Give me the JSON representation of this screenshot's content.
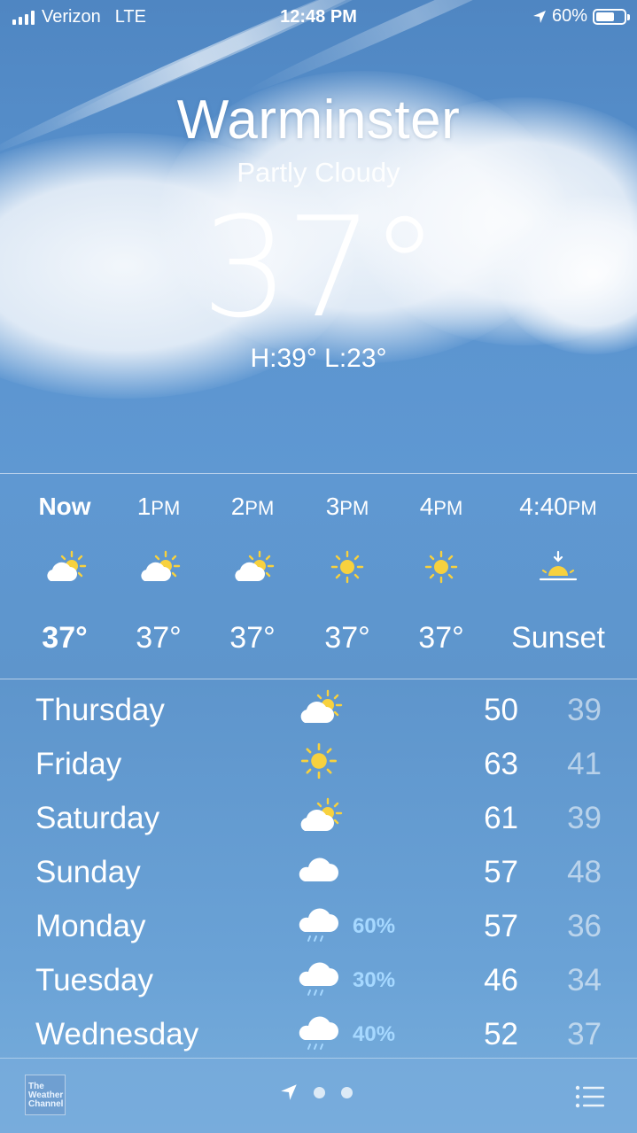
{
  "status_bar": {
    "carrier": "Verizon",
    "network": "LTE",
    "time": "12:48 PM",
    "battery": "60%",
    "battery_level": 0.6,
    "icons": [
      "signal-bars-icon",
      "location-arrow-icon",
      "battery-icon"
    ]
  },
  "location": {
    "city": "Warminster",
    "condition": "Partly Cloudy",
    "temperature": "37°",
    "high_low": "H:39°  L:23°"
  },
  "hourly": [
    {
      "time": "Now",
      "icon": "partly-cloudy-icon",
      "temp": "37°",
      "bold": true
    },
    {
      "time": "1",
      "suffix": "PM",
      "icon": "partly-cloudy-icon",
      "temp": "37°"
    },
    {
      "time": "2",
      "suffix": "PM",
      "icon": "partly-cloudy-icon",
      "temp": "37°"
    },
    {
      "time": "3",
      "suffix": "PM",
      "icon": "sun-icon",
      "temp": "37°"
    },
    {
      "time": "4",
      "suffix": "PM",
      "icon": "sun-icon",
      "temp": "37°"
    },
    {
      "time": "4:40",
      "suffix": "PM",
      "icon": "sunset-icon",
      "temp": "Sunset"
    }
  ],
  "daily": [
    {
      "day": "Thursday",
      "icon": "partly-cloudy-icon",
      "pop": "",
      "high": "50",
      "low": "39"
    },
    {
      "day": "Friday",
      "icon": "sun-icon",
      "pop": "",
      "high": "63",
      "low": "41"
    },
    {
      "day": "Saturday",
      "icon": "partly-cloudy-icon",
      "pop": "",
      "high": "61",
      "low": "39"
    },
    {
      "day": "Sunday",
      "icon": "cloud-icon",
      "pop": "",
      "high": "57",
      "low": "48"
    },
    {
      "day": "Monday",
      "icon": "rain-icon",
      "pop": "60%",
      "high": "57",
      "low": "36"
    },
    {
      "day": "Tuesday",
      "icon": "rain-icon",
      "pop": "30%",
      "high": "46",
      "low": "34"
    },
    {
      "day": "Wednesday",
      "icon": "rain-icon",
      "pop": "40%",
      "high": "52",
      "low": "37"
    }
  ],
  "toolbar": {
    "logo_text": "The Weather Channel",
    "page_count": 3,
    "icons": [
      "weather-channel-logo",
      "location-arrow-icon",
      "page-dot-icon",
      "city-list-icon"
    ]
  },
  "colors": {
    "sky_top": "#4f86c2",
    "sky_bottom": "#78aedc",
    "sun": "#f7d13e",
    "precip": "#a6d8ff"
  }
}
